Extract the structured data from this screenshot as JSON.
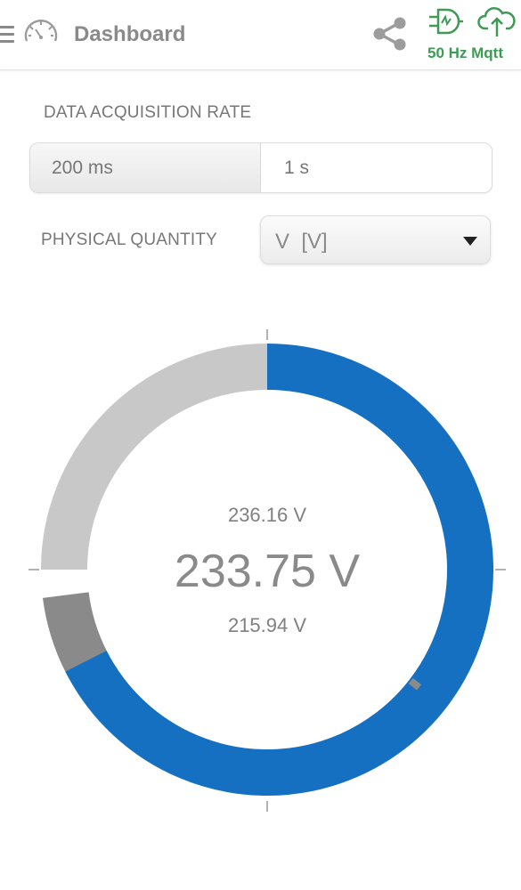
{
  "header": {
    "title": "Dashboard",
    "status_text": "50 Hz Mqtt",
    "icons": {
      "menu": "hamburger-menu-icon",
      "app": "speedometer-icon",
      "share": "share-icon",
      "plug": "plug-connection-icon",
      "cloud": "cloud-upload-icon"
    },
    "status_color": "#3f9a55"
  },
  "acquisition": {
    "label": "DATA ACQUISITION RATE",
    "options": [
      "200 ms",
      "1 s"
    ],
    "selected": "200 ms"
  },
  "quantity": {
    "label": "PHYSICAL QUANTITY",
    "selected_value": "V  [V]"
  },
  "gauge": {
    "value_text": "233.75 V",
    "max_text": "236.16 V",
    "min_text": "215.94 V",
    "value": 233.75,
    "max": 236.16,
    "min": 215.94,
    "fill_fraction": 0.75,
    "colors": {
      "fill": "#1670c2",
      "remainder": "#c8c8c8",
      "marker_band": "#8a8a8a"
    }
  }
}
